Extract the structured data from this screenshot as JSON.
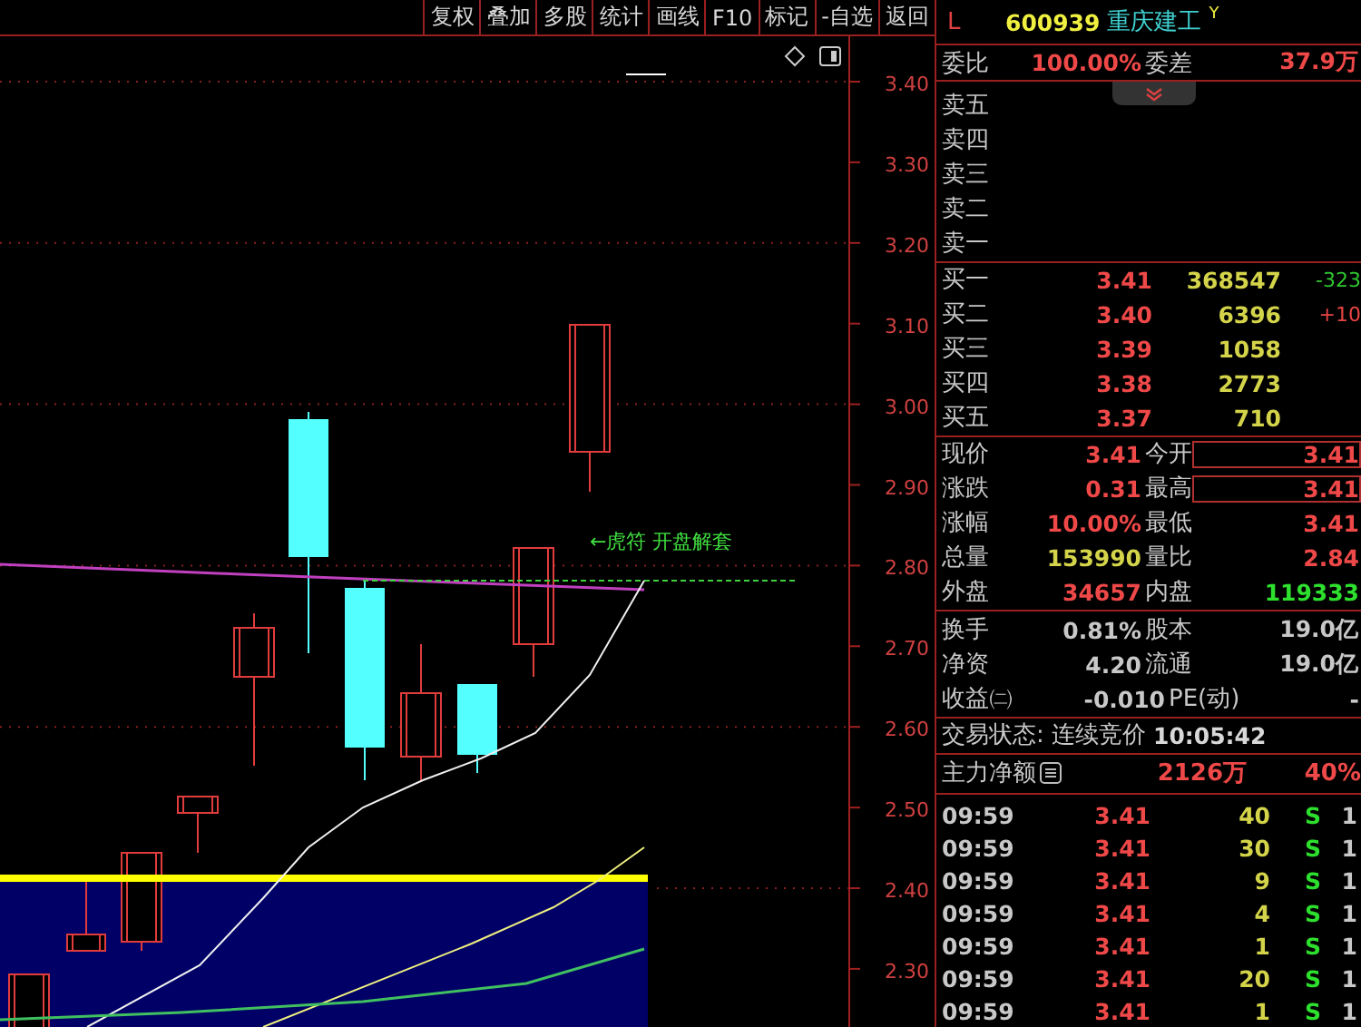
{
  "toolbar": [
    "复权",
    "叠加",
    "多股",
    "统计",
    "画线",
    "F10",
    "标记",
    "-自选",
    "返回"
  ],
  "chart": {
    "y_labels": [
      "3.40",
      "3.30",
      "3.20",
      "3.10",
      "3.00",
      "2.90",
      "2.80",
      "2.70",
      "2.60",
      "2.50",
      "2.40",
      "2.30"
    ],
    "annotation": "←虎符 开盘解套"
  },
  "header": {
    "market": "L",
    "code": "600939",
    "name": "重庆建工",
    "suffix": "Y"
  },
  "commission": {
    "label": "委比",
    "value": "100.00%",
    "label2": "委差",
    "value2": "37.9万"
  },
  "asks": [
    {
      "label": "卖五"
    },
    {
      "label": "卖四"
    },
    {
      "label": "卖三"
    },
    {
      "label": "卖二"
    },
    {
      "label": "卖一"
    }
  ],
  "bids": [
    {
      "label": "买一",
      "price": "3.41",
      "volume": "368547",
      "change": "-323",
      "color": "#2fc62f"
    },
    {
      "label": "买二",
      "price": "3.40",
      "volume": "6396",
      "change": "+10",
      "color": "#e84444"
    },
    {
      "label": "买三",
      "price": "3.39",
      "volume": "1058"
    },
    {
      "label": "买四",
      "price": "3.38",
      "volume": "2773"
    },
    {
      "label": "买五",
      "price": "3.37",
      "volume": "710"
    }
  ],
  "quotes": [
    [
      {
        "label": "现价",
        "value": "3.41",
        "color": "#ef4848",
        "boxed": false
      },
      {
        "label": "今开",
        "value": "3.41",
        "color": "#ef4848",
        "boxed": true
      }
    ],
    [
      {
        "label": "涨跌",
        "value": "0.31",
        "color": "#ef4848",
        "boxed": false
      },
      {
        "label": "最高",
        "value": "3.41",
        "color": "#ef4848",
        "boxed": true
      }
    ],
    [
      {
        "label": "涨幅",
        "value": "10.00%",
        "color": "#ef4848",
        "boxed": false
      },
      {
        "label": "最低",
        "value": "3.41",
        "color": "#ef4848",
        "boxed": false
      }
    ],
    [
      {
        "label": "总量",
        "value": "153990",
        "color": "#d4d44a",
        "boxed": false
      },
      {
        "label": "量比",
        "value": "2.84",
        "color": "#ef4848",
        "boxed": false
      }
    ],
    [
      {
        "label": "外盘",
        "value": "34657",
        "color": "#ef4848",
        "boxed": false
      },
      {
        "label": "内盘",
        "value": "119333",
        "color": "#2ee02e",
        "boxed": false
      }
    ]
  ],
  "stats": [
    {
      "label": "换手",
      "value": "0.81%",
      "label2": "股本",
      "value2": "19.0亿"
    },
    {
      "label": "净资",
      "value": "4.20",
      "label2": "流通",
      "value2": "19.0亿"
    },
    {
      "label": "收益㈡",
      "value": "-0.010",
      "label2": "PE(动)",
      "value2": "-"
    }
  ],
  "status": {
    "text": "交易状态: 连续竞价",
    "time": "10:05:42"
  },
  "main_flow": {
    "label": "主力净额",
    "amount": "2126万",
    "percent": "40%"
  },
  "ticks": [
    {
      "time": "09:59",
      "price": "3.41",
      "volume": "40",
      "side": "S",
      "count": "1"
    },
    {
      "time": "09:59",
      "price": "3.41",
      "volume": "30",
      "side": "S",
      "count": "1"
    },
    {
      "time": "09:59",
      "price": "3.41",
      "volume": "9",
      "side": "S",
      "count": "1"
    },
    {
      "time": "09:59",
      "price": "3.41",
      "volume": "4",
      "side": "S",
      "count": "1"
    },
    {
      "time": "09:59",
      "price": "3.41",
      "volume": "1",
      "side": "S",
      "count": "1"
    },
    {
      "time": "09:59",
      "price": "3.41",
      "volume": "20",
      "side": "S",
      "count": "1"
    },
    {
      "time": "09:59",
      "price": "3.41",
      "volume": "1",
      "side": "S",
      "count": "1"
    }
  ]
}
